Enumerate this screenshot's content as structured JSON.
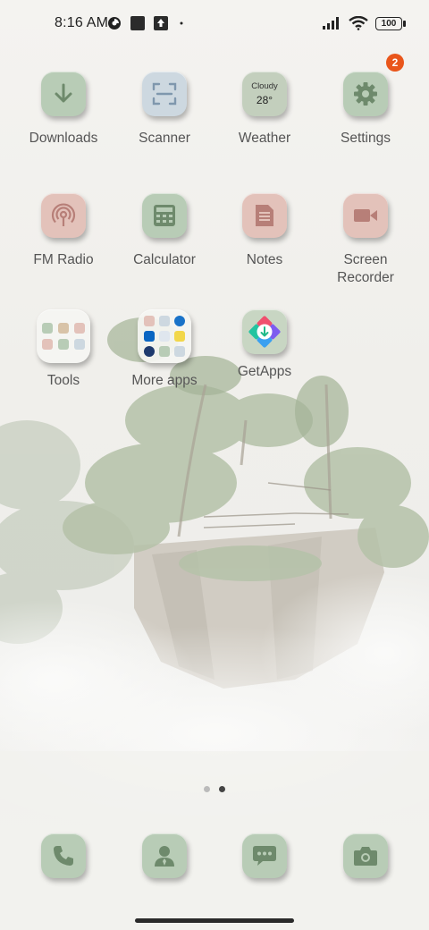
{
  "status_bar": {
    "time": "8:16 AM",
    "battery": "100",
    "icons": [
      "data-saver-icon",
      "square-notification-icon",
      "upload-icon",
      "dot-icon",
      "signal-icon",
      "wifi-icon",
      "battery-icon"
    ]
  },
  "apps": {
    "downloads": {
      "label": "Downloads",
      "icon": "download-arrow-icon"
    },
    "scanner": {
      "label": "Scanner",
      "icon": "scan-frame-icon"
    },
    "weather": {
      "label": "Weather",
      "condition": "Cloudy",
      "temp": "28°",
      "icon": "weather-widget-icon"
    },
    "settings": {
      "label": "Settings",
      "badge": "2",
      "icon": "gear-icon"
    },
    "fm_radio": {
      "label": "FM Radio",
      "icon": "radio-icon"
    },
    "calculator": {
      "label": "Calculator",
      "icon": "calculator-icon"
    },
    "notes": {
      "label": "Notes",
      "icon": "notes-icon"
    },
    "screen_recorder": {
      "label": "Screen\nRecorder",
      "icon": "video-camera-icon"
    },
    "tools": {
      "label": "Tools",
      "icon": "folder-icon"
    },
    "more_apps": {
      "label": "More apps",
      "icon": "folder-icon"
    },
    "getapps": {
      "label": "GetApps",
      "icon": "getapps-icon"
    }
  },
  "page_indicator": {
    "count": 2,
    "active": 2
  },
  "dock": [
    "phone-icon",
    "contacts-icon",
    "messages-icon",
    "camera-icon"
  ],
  "colors": {
    "tile_green": "#b8ccb6",
    "tile_blue": "#cdd8e0",
    "tile_pink": "#e3c2ba",
    "badge": "#e9561b",
    "icon_green": "#6e8a6c"
  }
}
